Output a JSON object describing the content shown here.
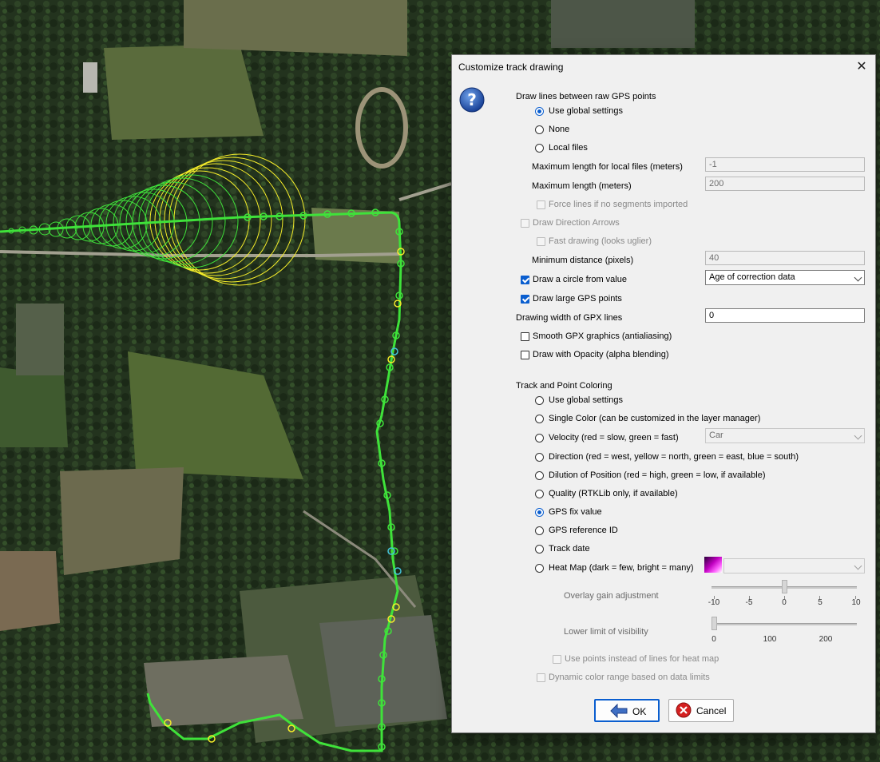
{
  "dialog": {
    "title": "Customize track drawing"
  },
  "section_lines": {
    "heading": "Draw lines between raw GPS points",
    "options": [
      "Use global settings",
      "None",
      "Local files"
    ],
    "selected": "Use global settings",
    "max_local_label": "Maximum length for local files (meters)",
    "max_local_value": "-1",
    "max_length_label": "Maximum length (meters)",
    "max_length_value": "200",
    "force_lines_label": "Force lines if no segments imported"
  },
  "arrows": {
    "draw_arrows_label": "Draw Direction Arrows",
    "fast_drawing_label": "Fast drawing (looks uglier)",
    "min_distance_label": "Minimum distance (pixels)",
    "min_distance_value": "40"
  },
  "circle": {
    "label": "Draw a circle from value",
    "checked": true,
    "combo_value": "Age of correction data"
  },
  "large_points": {
    "label": "Draw large GPS points",
    "checked": true
  },
  "gpx_width": {
    "label": "Drawing width of GPX lines",
    "value": "0"
  },
  "smooth": {
    "label": "Smooth GPX graphics (antialiasing)",
    "checked": false
  },
  "opacity": {
    "label": "Draw with Opacity (alpha blending)",
    "checked": false
  },
  "coloring": {
    "heading": "Track and Point Coloring",
    "options": [
      "Use global settings",
      "Single Color (can be customized in the layer manager)",
      "Velocity (red = slow, green = fast)",
      "Direction (red = west, yellow = north, green = east, blue = south)",
      "Dilution of Position (red = high, green = low, if available)",
      "Quality (RTKLib only, if available)",
      "GPS fix value",
      "GPS reference ID",
      "Track date",
      "Heat Map (dark = few, bright = many)"
    ],
    "selected": "GPS fix value",
    "velocity_combo": "Car"
  },
  "heatmap": {
    "gain_label": "Overlay gain adjustment",
    "gain_value": 0,
    "gain_ticks": [
      "-10",
      "-5",
      "0",
      "5",
      "10"
    ],
    "visibility_label": "Lower limit of visibility",
    "visibility_value": 0,
    "visibility_ticks": [
      "0",
      "100",
      "200"
    ],
    "use_points_label": "Use points instead of lines for heat map",
    "dynamic_range_label": "Dynamic color range based on data limits"
  },
  "buttons": {
    "ok": "OK",
    "cancel": "Cancel"
  },
  "colors": {
    "accent": "#0a5ecf",
    "track_green": "#3fe23a",
    "track_yellow": "#f4ec2a",
    "track_cyan": "#43c3d9"
  }
}
